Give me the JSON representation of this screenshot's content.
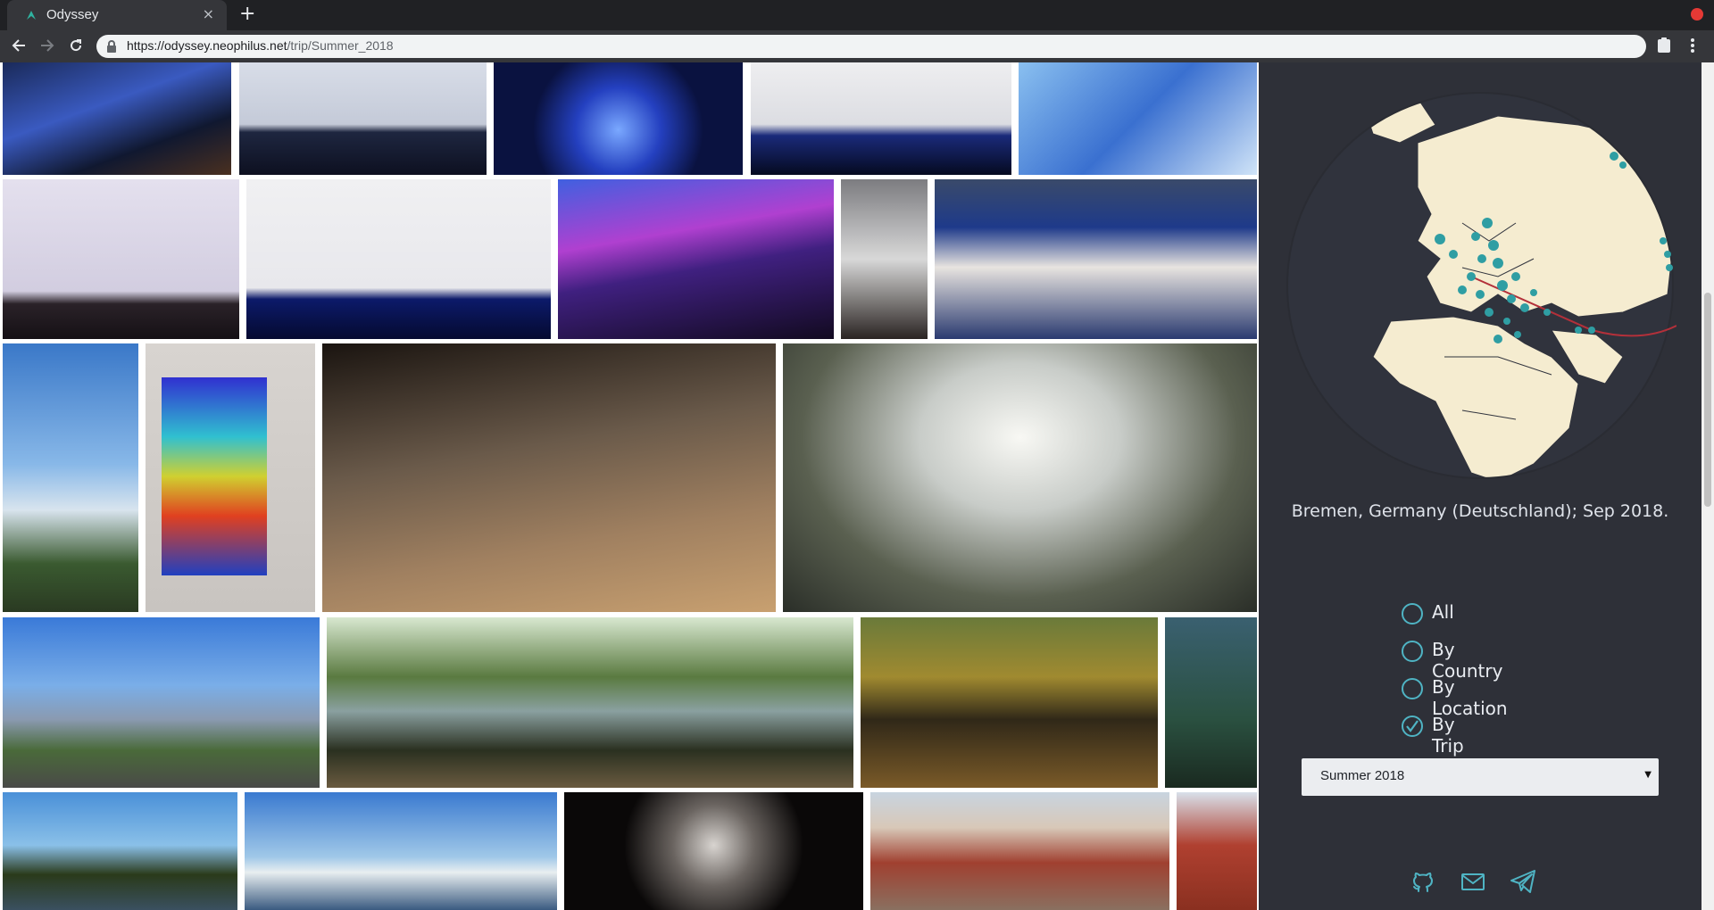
{
  "browser": {
    "tab_title": "Odyssey",
    "tab_close": "×",
    "new_tab": "+",
    "url_host": "https://odyssey.neophilus.net",
    "url_path": "/trip/Summer_2018"
  },
  "gallery": {
    "photos": [
      {
        "name": "astronaut-panel",
        "desc": "astronaut on stage screen"
      },
      {
        "name": "conference-slide-panel",
        "desc": "panel slide"
      },
      {
        "name": "stage-lights-earth",
        "desc": "stage with earth visual"
      },
      {
        "name": "rocket-presentation",
        "desc": "rocket presentation"
      },
      {
        "name": "rocket-sky",
        "desc": "rocket screen"
      },
      {
        "name": "blue-origin-panel",
        "desc": "panel slide"
      },
      {
        "name": "australian-space-stage",
        "desc": "IAC stage"
      },
      {
        "name": "lighthouse-party",
        "desc": "party hall"
      },
      {
        "name": "satellite-model",
        "desc": "satellite model"
      },
      {
        "name": "australian-space-booth",
        "desc": "booth"
      },
      {
        "name": "drop-tower",
        "desc": "tower"
      },
      {
        "name": "thermal-camera",
        "desc": "thermal camera"
      },
      {
        "name": "museum-staircase",
        "desc": "staircase"
      },
      {
        "name": "tube-walkway",
        "desc": "walkway tube"
      },
      {
        "name": "universum-building",
        "desc": "museum building"
      },
      {
        "name": "park-pond",
        "desc": "park pond"
      },
      {
        "name": "river-autumn",
        "desc": "river"
      },
      {
        "name": "statue-garden",
        "desc": "statue"
      },
      {
        "name": "lake-park",
        "desc": "lake"
      },
      {
        "name": "lake-building",
        "desc": "lake building"
      },
      {
        "name": "outdoor-cinema",
        "desc": "cinema"
      },
      {
        "name": "market-square",
        "desc": "market square"
      },
      {
        "name": "cathedral",
        "desc": "cathedral"
      }
    ]
  },
  "panel": {
    "location_text": "Bremen, Germany (Deutschland); Sep 2018.",
    "options": [
      {
        "label": "All",
        "checked": false
      },
      {
        "label": "By Country",
        "checked": false
      },
      {
        "label": "By Location",
        "checked": false
      },
      {
        "label": "By Trip",
        "checked": true
      }
    ],
    "trip_select_value": "Summer 2018",
    "select_arrow": "▼"
  },
  "colors": {
    "panel_bg": "#2e3038",
    "globe_land": "#f5ecd0",
    "globe_sea": "#30333d",
    "marker": "#2f9ea3",
    "route": "#b3303a"
  },
  "icons": [
    "github-icon",
    "mail-icon",
    "telegram-icon"
  ]
}
